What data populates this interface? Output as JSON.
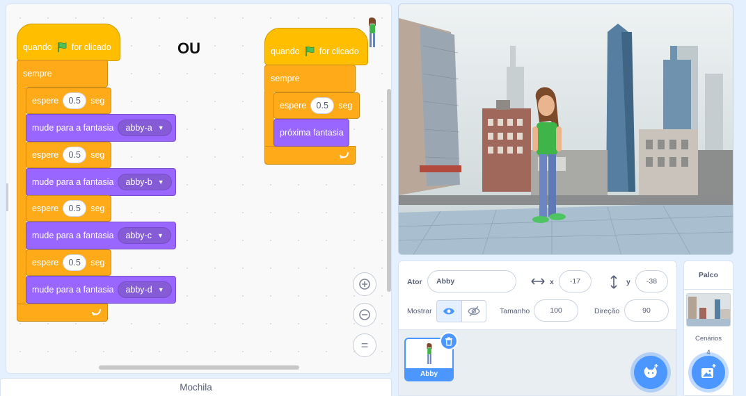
{
  "code": {
    "ou_label": "OU",
    "script1": {
      "hat": {
        "quando": "quando",
        "for_clicado": "for clicado"
      },
      "forever": "sempre",
      "wait_label": "espere",
      "wait_unit": "seg",
      "wait_value": "0.5",
      "switch_label": "mude para a fantasia",
      "costumes": [
        "abby-a",
        "abby-b",
        "abby-c",
        "abby-d"
      ]
    },
    "script2": {
      "hat": {
        "quando": "quando",
        "for_clicado": "for clicado"
      },
      "forever": "sempre",
      "wait_label": "espere",
      "wait_value": "0.5",
      "wait_unit": "seg",
      "next_costume": "próxima fantasia"
    },
    "zoom": {
      "in": "+",
      "out": "−",
      "reset": "="
    }
  },
  "backpack": {
    "label": "Mochila"
  },
  "sprite_info": {
    "ator_label": "Ator",
    "name": "Abby",
    "x_label": "x",
    "x": "-17",
    "y_label": "y",
    "y": "-38",
    "mostrar_label": "Mostrar",
    "tamanho_label": "Tamanho",
    "tamanho": "100",
    "direcao_label": "Direção",
    "direcao": "90"
  },
  "sprite_list": [
    {
      "name": "Abby",
      "selected": true
    }
  ],
  "stage_pane": {
    "title": "Palco",
    "backdrops_label": "Cenários",
    "backdrops_count": "4"
  },
  "colors": {
    "events": "#ffbf00",
    "control": "#ffab19",
    "looks": "#9966ff",
    "accent": "#4c97ff"
  },
  "icons": {
    "flag": "green-flag-icon",
    "loop_arrow": "loop-arrow-icon",
    "eye": "eye-icon",
    "eye_off": "eye-off-icon",
    "trash": "trash-icon",
    "add_sprite": "cat-plus-icon",
    "add_backdrop": "image-plus-icon"
  }
}
